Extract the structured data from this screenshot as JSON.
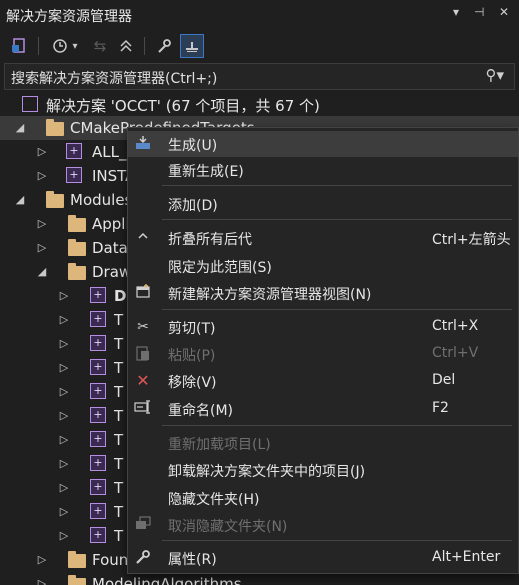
{
  "window": {
    "title": "解决方案资源管理器",
    "controls": {
      "dropdown": "▾",
      "pin": "⊣",
      "close": "✕"
    }
  },
  "toolbar": {
    "buttons": [
      "switch-views-icon",
      "history-icon",
      "back-icon",
      "collapse-all-icon",
      "properties-wrench-icon",
      "preview-icon"
    ]
  },
  "search": {
    "placeholder": "搜索解决方案资源管理器(Ctrl+;)",
    "icon": "search-icon"
  },
  "tree": {
    "solution_label": "解决方案 'OCCT' (67 个项目，共 67 个)",
    "items": [
      {
        "label": "CMakePredefinedTargets"
      },
      {
        "label": "ALL_BUILD"
      },
      {
        "label": "INSTALL"
      },
      {
        "label": "Modules"
      },
      {
        "label": "ApplicationFramework"
      },
      {
        "label": "DataExchange"
      },
      {
        "label": "Draw"
      },
      {
        "label": "D"
      },
      {
        "label": "T"
      },
      {
        "label": "T"
      },
      {
        "label": "T"
      },
      {
        "label": "T"
      },
      {
        "label": "T"
      },
      {
        "label": "T"
      },
      {
        "label": "T"
      },
      {
        "label": "T"
      },
      {
        "label": "T"
      },
      {
        "label": "T"
      },
      {
        "label": "FoundationClasses"
      },
      {
        "label": "ModelingAlgorithms"
      }
    ]
  },
  "context_menu": {
    "items": [
      {
        "label": "生成(U)",
        "shortcut": "",
        "icon": "build-icon"
      },
      {
        "label": "重新生成(E)",
        "shortcut": ""
      },
      {
        "label": "添加(D)",
        "shortcut": ""
      },
      {
        "label": "折叠所有后代",
        "shortcut": "Ctrl+左箭头",
        "icon": "collapse-icon"
      },
      {
        "label": "限定为此范围(S)",
        "shortcut": ""
      },
      {
        "label": "新建解决方案资源管理器视图(N)",
        "shortcut": "",
        "icon": "new-view-icon"
      },
      {
        "label": "剪切(T)",
        "shortcut": "Ctrl+X",
        "icon": "cut-icon"
      },
      {
        "label": "粘贴(P)",
        "shortcut": "Ctrl+V",
        "icon": "paste-icon",
        "disabled": true
      },
      {
        "label": "移除(V)",
        "shortcut": "Del",
        "icon": "remove-icon"
      },
      {
        "label": "重命名(M)",
        "shortcut": "F2",
        "icon": "rename-icon"
      },
      {
        "label": "重新加载项目(L)",
        "shortcut": "",
        "disabled": true
      },
      {
        "label": "卸载解决方案文件夹中的项目(J)",
        "shortcut": ""
      },
      {
        "label": "隐藏文件夹(H)",
        "shortcut": ""
      },
      {
        "label": "取消隐藏文件夹(N)",
        "shortcut": "",
        "icon": "unhide-icon",
        "disabled": true
      },
      {
        "label": "属性(R)",
        "shortcut": "Alt+Enter",
        "icon": "properties-wrench-icon"
      }
    ]
  },
  "colors": {
    "background": "#1f1f1f",
    "menu_background": "#252526",
    "folder": "#dcb67a",
    "project": "#b48ee0",
    "remove": "#e05555",
    "accent": "#3b78c4"
  }
}
